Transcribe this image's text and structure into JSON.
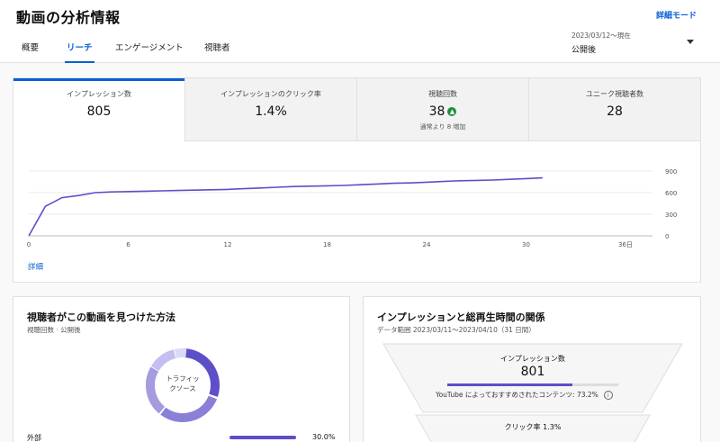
{
  "header": {
    "title": "動画の分析情報",
    "detail_mode": "詳細モード",
    "tabs": [
      {
        "label": "概要",
        "active": false
      },
      {
        "label": "リーチ",
        "active": true
      },
      {
        "label": "エンゲージメント",
        "active": false
      },
      {
        "label": "視聴者",
        "active": false
      }
    ],
    "date_range": "2023/03/12～現在",
    "date_label": "公開後",
    "dropdown_icon": "caret-down-icon"
  },
  "metrics": [
    {
      "label": "インプレッション数",
      "value": "805",
      "active": true
    },
    {
      "label": "インプレッションのクリック率",
      "value": "1.4%",
      "active": false
    },
    {
      "label": "視聴回数",
      "value": "38",
      "sub": "通常より 8 増加",
      "icon": "arrow-up-icon",
      "active": false
    },
    {
      "label": "ユニーク視聴者数",
      "value": "28",
      "active": false
    }
  ],
  "colors": {
    "accent": "#065fd4",
    "line": "#5c4fc8",
    "up": "#1e8e3e"
  },
  "chart_data": {
    "type": "line",
    "x": [
      0,
      1,
      2,
      3,
      4,
      5,
      6,
      7,
      8,
      9,
      10,
      11,
      12,
      13,
      14,
      15,
      16,
      17,
      18,
      19,
      20,
      21,
      22,
      23,
      24,
      25,
      26,
      27,
      28,
      29,
      30,
      31
    ],
    "series": [
      {
        "values": [
          0,
          410,
          530,
          560,
          600,
          610,
          615,
          620,
          625,
          630,
          635,
          640,
          645,
          655,
          665,
          675,
          685,
          690,
          695,
          700,
          710,
          720,
          730,
          735,
          745,
          755,
          765,
          770,
          775,
          785,
          795,
          805
        ]
      }
    ],
    "xticks": [
      "0",
      "6",
      "12",
      "18",
      "24",
      "30",
      "36日"
    ],
    "xtick_values": [
      0,
      6,
      12,
      18,
      24,
      30,
      36
    ],
    "yticks": [
      "900",
      "600",
      "300",
      "0"
    ],
    "ytick_values": [
      900,
      600,
      300,
      0
    ],
    "xlim": [
      0,
      36
    ],
    "ylim": [
      0,
      900
    ],
    "grid": true
  },
  "chart_footer": {
    "detail_link": "詳細"
  },
  "traffic_card": {
    "title": "視聴者がこの動画を見つけた方法",
    "subtitle": "視聴回数 · 公開後",
    "donut_label": "トラフィックソース",
    "row_label": "外部",
    "row_value": "30.0%",
    "row_fraction": 0.3
  },
  "funnel_card": {
    "title": "インプレッションと総再生時間の関係",
    "subtitle": "データ範囲 2023/03/11～2023/04/10（31 日間）",
    "impressions_label": "インプレッション数",
    "impressions_value": "801",
    "recommend_note": "YouTube によっておすすめされたコンテンツ: 73.2%",
    "recommend_fraction": 0.732,
    "ctr_label": "クリック率 1.3%",
    "info_icon": "info-icon"
  }
}
